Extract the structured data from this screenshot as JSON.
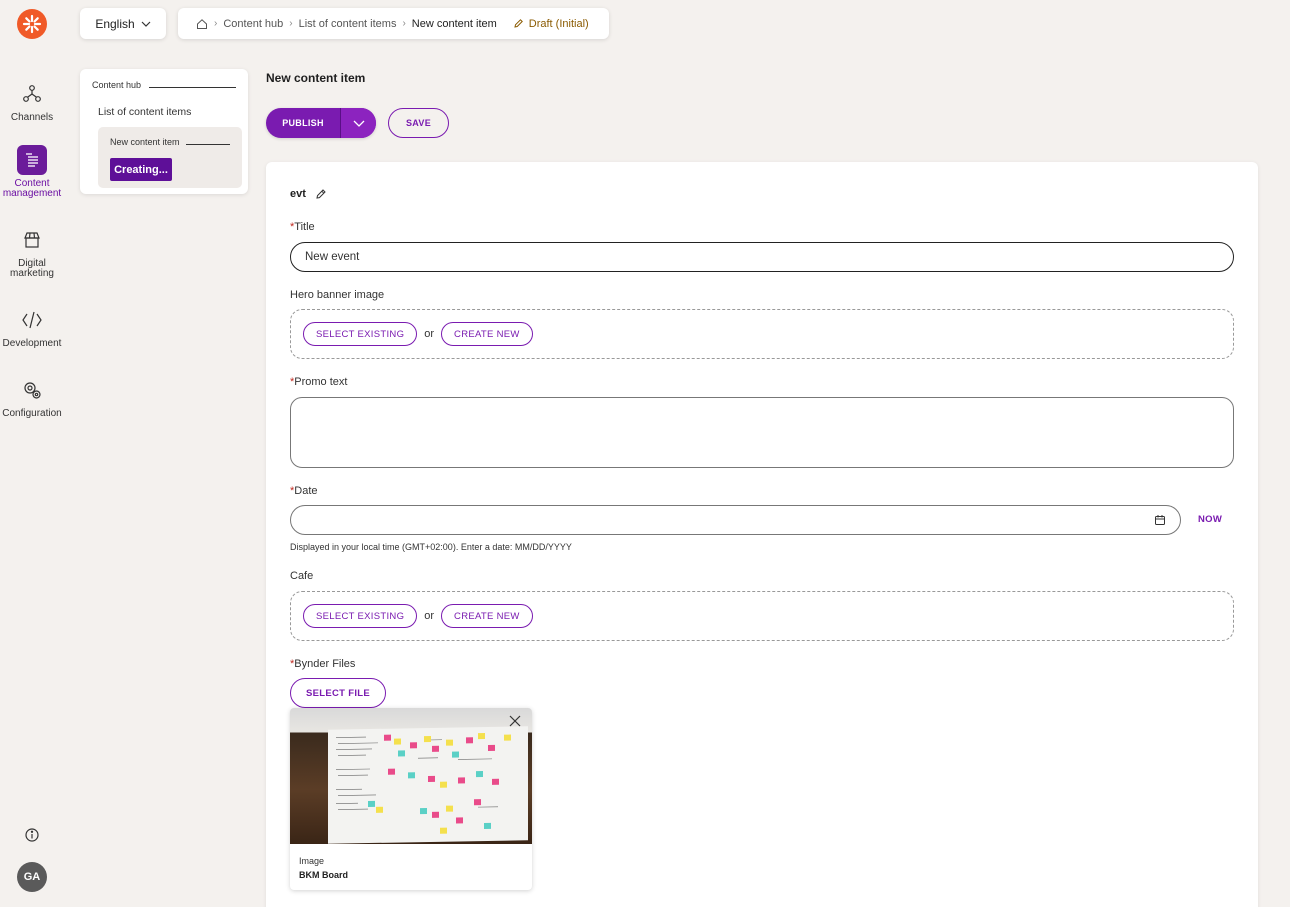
{
  "nav": {
    "items": [
      {
        "label": "Channels",
        "icon": "channels-icon"
      },
      {
        "label": "Content management",
        "icon": "content-management-icon"
      },
      {
        "label": "Digital marketing",
        "icon": "digital-marketing-icon"
      },
      {
        "label": "Development",
        "icon": "development-icon"
      },
      {
        "label": "Configuration",
        "icon": "configuration-icon"
      }
    ],
    "avatar": "GA"
  },
  "topbar": {
    "language": "English",
    "breadcrumbs": [
      "Content hub",
      "List of content items",
      "New content item"
    ],
    "status": "Draft (Initial)"
  },
  "tree": {
    "root": "Content hub",
    "list": "List of content items",
    "item": "New content item",
    "creating": "Creating..."
  },
  "header": {
    "title": "New content item",
    "publish_label": "PUBLISH",
    "save_label": "SAVE"
  },
  "form": {
    "type_name": "evt",
    "title": {
      "label": "Title",
      "value": "New event",
      "required": "*"
    },
    "hero": {
      "label": "Hero banner image",
      "select": "SELECT EXISTING",
      "or": "or",
      "create": "CREATE NEW"
    },
    "promo": {
      "label": "Promo text",
      "required": "*"
    },
    "date": {
      "label": "Date",
      "required": "*",
      "now": "NOW",
      "hint": "Displayed in your local time (GMT+02:00). Enter a date: MM/DD/YYYY"
    },
    "cafe": {
      "label": "Cafe",
      "select": "SELECT EXISTING",
      "or": "or",
      "create": "CREATE NEW"
    },
    "bynder": {
      "label": "Bynder Files",
      "required": "*",
      "select_file": "SELECT FILE",
      "file_kind": "Image",
      "file_name": "BKM Board"
    }
  },
  "colors": {
    "accent": "#7a1bb0",
    "brand": "#f05a28",
    "required": "#c0281e"
  }
}
